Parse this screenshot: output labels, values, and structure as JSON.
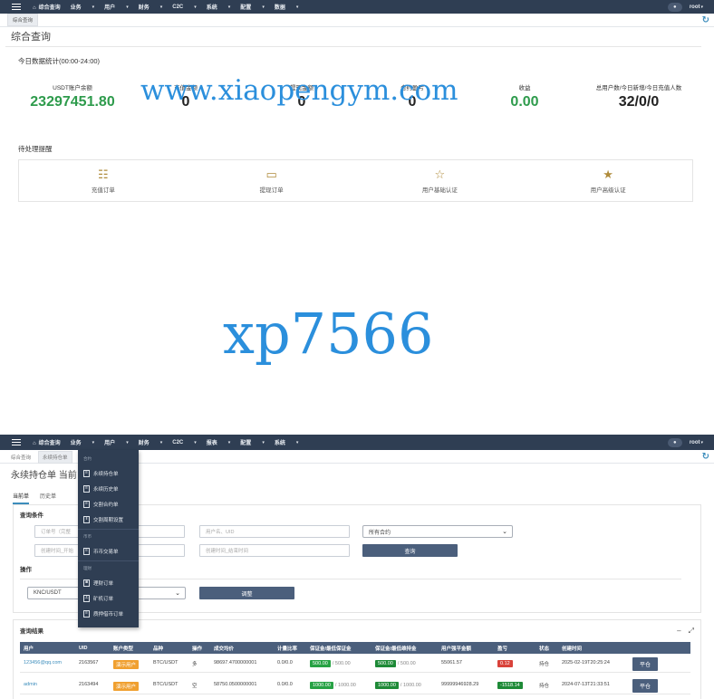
{
  "colors": {
    "topbar": "#2f3e53",
    "accent": "#3c8dbc",
    "green": "#2e9b4c",
    "gold": "#b08c3c",
    "button": "#4b5f7c",
    "watermark": "#2b8fdc"
  },
  "top1": {
    "nav": [
      "综合查询",
      "业务",
      "用户",
      "财务",
      "C2C",
      "系统",
      "配置",
      "数据"
    ],
    "user": "root"
  },
  "page1": {
    "tab": "综合查询",
    "title": "综合查询",
    "today_title": "今日数据统计(00:00-24:00)",
    "stats": [
      {
        "label": "USDT账户余额",
        "value": "23297451.80"
      },
      {
        "label": "充值金额",
        "value": "0"
      },
      {
        "label": "提现金额",
        "value": "0"
      },
      {
        "label": "合约盈亏",
        "value": "0"
      },
      {
        "label": "收益",
        "value": "0.00"
      },
      {
        "label": "总用户数/今日新增/今日充值人数",
        "value": "32/0/0"
      }
    ],
    "pending_title": "待处理提醒",
    "pending": [
      {
        "label": "充值订单",
        "icon": "qrcode-icon"
      },
      {
        "label": "提现订单",
        "icon": "card-icon"
      },
      {
        "label": "用户基础认证",
        "icon": "star-outline-icon"
      },
      {
        "label": "用户高级认证",
        "icon": "star-filled-icon"
      }
    ]
  },
  "watermarks": {
    "url": "www.xiaopengym.com",
    "code": "xp7566"
  },
  "top2": {
    "nav": [
      "综合查询",
      "业务",
      "用户",
      "财务",
      "C2C",
      "报表",
      "配置",
      "系统"
    ],
    "user": "root"
  },
  "page2": {
    "tabs": [
      "综合查询",
      "永续持仓单"
    ],
    "title": "永续持仓单 当前",
    "subtabs": [
      "当前单",
      "历史单"
    ],
    "query_title": "查询条件",
    "order_placeholder": "订单号（完整",
    "user_placeholder": "用户名、UID",
    "all_contracts": "所有合约",
    "created_placeholder": "创建时间_开始",
    "created_end_placeholder": "创建时间_结束时间",
    "query_btn": "查询",
    "op_title": "操作",
    "symbol": "KNC/USDT",
    "adjust_btn": "调整",
    "result_title": "查询结果",
    "dropdown": {
      "groups": [
        {
          "name": "合约",
          "items": [
            {
              "label": "永续持仓单",
              "icon": "document-icon"
            },
            {
              "label": "永续历史单",
              "icon": "document-icon"
            },
            {
              "label": "交割合约单",
              "icon": "document-icon"
            },
            {
              "label": "交割周期设置",
              "icon": "columns-icon"
            }
          ]
        },
        {
          "name": "币币",
          "items": [
            {
              "label": "币币交易单",
              "icon": "document-icon"
            }
          ]
        },
        {
          "name": "理财",
          "items": [
            {
              "label": "理财订单",
              "icon": "folder-icon"
            },
            {
              "label": "矿机订单",
              "icon": "anchor-icon"
            },
            {
              "label": "质押借币订单",
              "icon": "document-icon"
            }
          ]
        }
      ]
    },
    "columns": [
      "用户",
      "UID",
      "账户类型",
      "品种",
      "操作",
      "成交均价",
      "计量比率",
      "保证金/最低保证金",
      "保证金/最低维持金",
      "用户强平金额",
      "盈亏",
      "状态",
      "创建时间",
      ""
    ],
    "rows": [
      {
        "user": "123456@qq.com",
        "uid": "2163567",
        "type": "演示用户",
        "symbol": "BTC/USDT",
        "side": "多",
        "price": "98697.4700000001",
        "ratio": "0.0/0.0",
        "margin": "500.00",
        "margin_total": "/ 500.00",
        "maint": "500.00",
        "maint_total": "/ 500.00",
        "liq": "55061.57",
        "pnl": "0.12",
        "status": "持仓",
        "time": "2025-02-19T20:25:24",
        "action": "平仓"
      },
      {
        "user": "admin",
        "uid": "2163494",
        "type": "演示用户",
        "symbol": "BTC/USDT",
        "side": "空",
        "price": "58750.0500000001",
        "ratio": "0.0/0.0",
        "margin": "1000.00",
        "margin_total": "/ 1000.00",
        "maint": "1000.00",
        "maint_total": "/ 1000.00",
        "liq": "99999946928.29",
        "pnl": "-1518.14",
        "status": "持仓",
        "time": "2024-07-13T21:33:51",
        "action": "平仓"
      }
    ]
  }
}
